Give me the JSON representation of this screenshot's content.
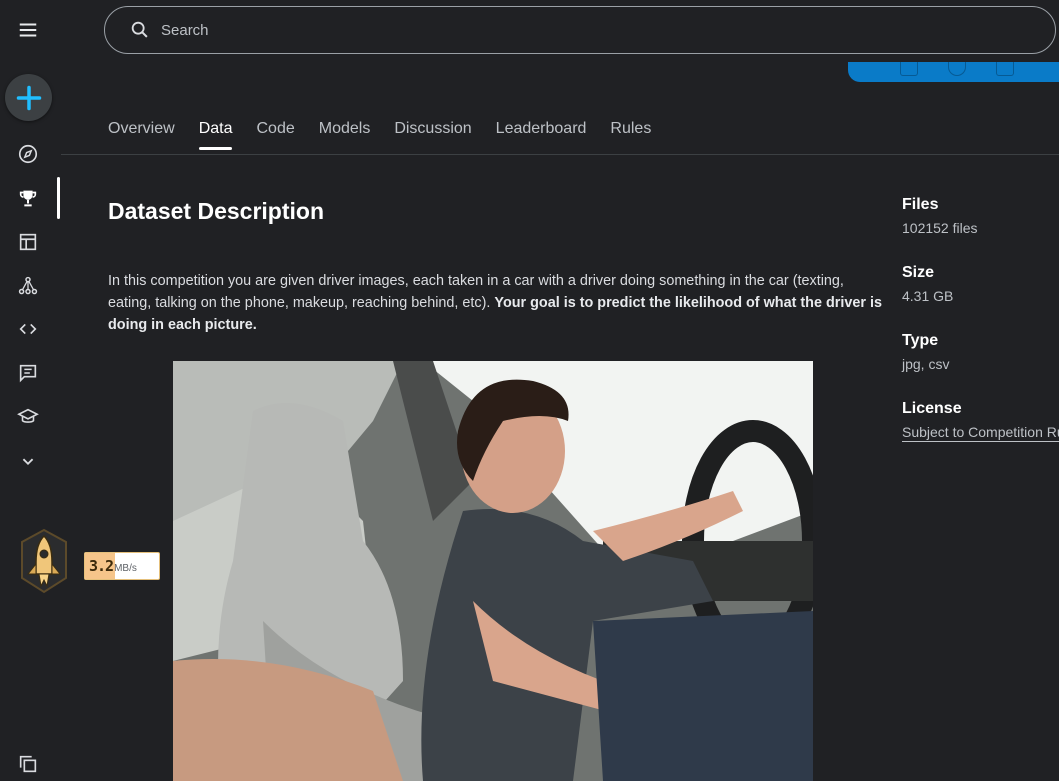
{
  "search": {
    "placeholder": "Search"
  },
  "sidebar": {
    "items": [
      {
        "name": "compass-icon"
      },
      {
        "name": "trophy-icon"
      },
      {
        "name": "table-icon"
      },
      {
        "name": "models-icon"
      },
      {
        "name": "code-icon"
      },
      {
        "name": "discussion-icon"
      },
      {
        "name": "learn-icon"
      },
      {
        "name": "chevron-down-icon"
      }
    ],
    "active": "trophy-icon"
  },
  "speed_widget": {
    "value": "3.2",
    "unit": "MB/s"
  },
  "tabs": [
    {
      "label": "Overview"
    },
    {
      "label": "Data"
    },
    {
      "label": "Code"
    },
    {
      "label": "Models"
    },
    {
      "label": "Discussion"
    },
    {
      "label": "Leaderboard"
    },
    {
      "label": "Rules"
    }
  ],
  "active_tab": "Data",
  "main": {
    "title": "Dataset Description",
    "description_plain": "In this competition you are given driver images, each taken in a car with a driver doing something in the car (texting, eating, talking on the phone, makeup, reaching behind, etc). ",
    "description_bold": "Your goal is to predict the likelihood of what the driver is doing in each picture."
  },
  "info": {
    "files_label": "Files",
    "files_value": "102152 files",
    "size_label": "Size",
    "size_value": "4.31 GB",
    "type_label": "Type",
    "type_value": "jpg, csv",
    "license_label": "License",
    "license_value": "Subject to Competition Rules"
  },
  "colors": {
    "accent": "#20beff",
    "banner": "#0a7bc8",
    "background": "#202124"
  }
}
